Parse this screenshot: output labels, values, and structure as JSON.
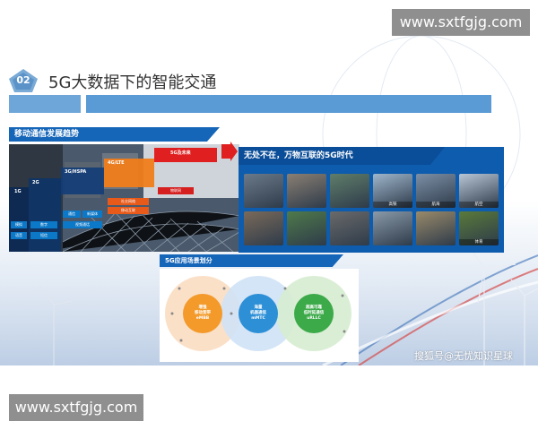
{
  "watermark": {
    "top": "www.sxtfgjg.com",
    "bottom": "www.sxtfgjg.com"
  },
  "slide": {
    "number": "02",
    "title": "5G大数据下的智能交通",
    "left_header": "移动通信发展趋势",
    "right_header": "无处不在，万物互联的5G时代",
    "bottom_header": "5G应用场景划分",
    "credit": "搜狐号@无忧知识星球"
  },
  "evolution": {
    "generations": [
      "1G",
      "2G",
      "3G/HSPA",
      "4G/LTE",
      "5G及未来"
    ],
    "cells": [
      "模拟",
      "语音",
      "数字",
      "短信",
      "通信",
      "新媒体",
      "视频通话",
      "社交网络",
      "移动互联",
      "物联网"
    ]
  },
  "scenes": {
    "tiles": [
      "",
      "",
      "",
      "高铁",
      "航海",
      "航空",
      "",
      "",
      "",
      "",
      "",
      "体育"
    ]
  },
  "scenarios": {
    "circles": [
      {
        "label": "增强\n移动宽带\neMBB",
        "color": "#f39a2b"
      },
      {
        "label": "海量\n机器通信\nmMTC",
        "color": "#2d8fd6"
      },
      {
        "label": "超高可靠\n低时延通信\nuRLLC",
        "color": "#3daa4a"
      }
    ]
  },
  "colors": {
    "accent_blue": "#1a7fd0",
    "header_blue": "#1565b8",
    "badge_blue": "#7aaad6"
  }
}
